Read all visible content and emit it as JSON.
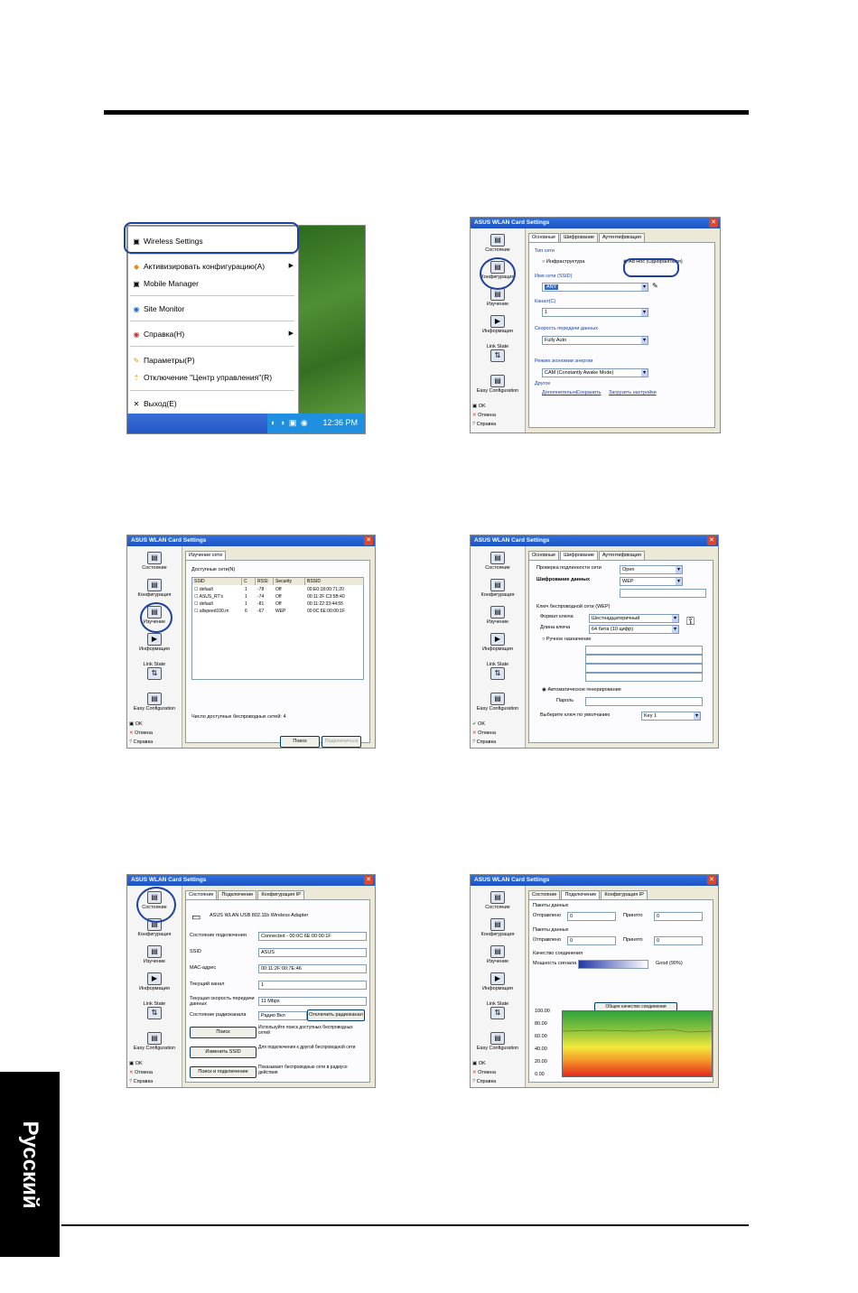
{
  "page": {
    "side_tab": "Русский"
  },
  "shot1": {
    "menu_items": [
      "Wireless Settings",
      "Активизировать конфигурацию(A)",
      "Mobile Manager",
      "Site Monitor",
      "Справка(H)",
      "Параметры(P)",
      "Отключение \"Центр управления\"(R)",
      "Выход(E)"
    ],
    "clock": "12:36 PM"
  },
  "shot2": {
    "title": "ASUS WLAN Card Settings",
    "tabs": [
      "Основные",
      "Шифрование",
      "Аутентификация"
    ],
    "nav": [
      "Состояние",
      "Конфигурация",
      "Изучение",
      "Информация",
      "Link State",
      "Easy Configuration",
      "OK",
      "Отмена",
      "Справка"
    ],
    "network_type_label": "Тип сети",
    "network_type_options": [
      "Инфраструктура",
      "Ad Hoc (Одноранговая)"
    ],
    "ssid_label": "Имя сети (SSID)",
    "ssid_value": "ANY",
    "channel_label": "Канал(C)",
    "channel_value": "1",
    "rate_label": "Скорость передачи данных",
    "rate_value": "Fully Auto",
    "power_label": "Режим экономии энергии",
    "power_value": "CAM (Constantly Awake Mode)",
    "other_label": "Другое",
    "links": [
      "Дополнительно",
      "Сохранить",
      "Загрузить настройки"
    ]
  },
  "shot3": {
    "title": "ASUS WLAN Card Settings",
    "tab": "Изучение сети",
    "list_label": "Доступные сети(N)",
    "columns": [
      "SSID",
      "C",
      "RSSI",
      "Security",
      "BSSID"
    ],
    "rows": [
      [
        "default",
        "1",
        "-78",
        "Off",
        "00:E0:18:00:71:20"
      ],
      [
        "ASUS_RT's",
        "1",
        "-74",
        "Off",
        "00:11:2F:C3:5B:40"
      ],
      [
        "default",
        "1",
        "-81",
        "Off",
        "00:11:22:33:44:55"
      ],
      [
        "allspeed100.m",
        "6",
        "-67",
        "WEP",
        "00:0C:6E:00:00:1F"
      ]
    ],
    "count_text": "Число доступных беспроводных сетей: 4",
    "buttons": [
      "Поиск",
      "Подключиться"
    ]
  },
  "shot4": {
    "title": "ASUS WLAN Card Settings",
    "tabs": [
      "Основные",
      "Шифрование",
      "Аутентификация"
    ],
    "rows": [
      {
        "label": "Проверка подлинности сети",
        "value": "Open"
      },
      {
        "label": "Шифрование данных",
        "value": "WEP"
      },
      {
        "label": "Формат ключа",
        "value": "Шестнадцатеричный"
      },
      {
        "label": "Длина ключа",
        "value": "64 бита (10 цифр)"
      }
    ],
    "key_section": "Ключ беспроводной сети (WEP)",
    "manual": "Ручное назначение",
    "auto": "Автоматическое генерирование",
    "phrase_label": "Пароль",
    "default_key_label": "Выберите ключ по умолчанию",
    "default_key_value": "Key 1"
  },
  "shot5": {
    "title": "ASUS WLAN Card Settings",
    "tabs": [
      "Состояние",
      "Подключение",
      "Конфигурация IP"
    ],
    "adapter": "ASUS WLAN USB 802.11b Wireless Adapter",
    "fields": [
      {
        "label": "Состояние подключения",
        "value": "Connected - 00:0C:6E:00:00:1F"
      },
      {
        "label": "SSID",
        "value": "ASUS"
      },
      {
        "label": "MAC-адрес",
        "value": "00:11:2F:00:7E:46"
      },
      {
        "label": "Текущий канал",
        "value": "1"
      },
      {
        "label": "Текущая скорость передачи данных",
        "value": "11 Mbps"
      },
      {
        "label": "Состояние радиоканала",
        "value": "Радио Вкл"
      }
    ],
    "radio_button": "Отключить радиоканал",
    "actions": [
      {
        "button": "Поиск",
        "desc": "Используйте поиск доступных беспроводных сетей"
      },
      {
        "button": "Изменить SSID",
        "desc": "Для подключения к другой беспроводной сети"
      },
      {
        "button": "Поиск и подключение",
        "desc": "Показывает беспроводные сети в радиусе действия"
      }
    ]
  },
  "shot6": {
    "title": "ASUS WLAN Card Settings",
    "tabs": [
      "Состояние",
      "Подключение",
      "Конфигурация IP"
    ],
    "groups": [
      {
        "title": "Пакеты данных",
        "left_label": "Отправлено",
        "left_value": "0",
        "right_label": "Принято",
        "right_value": "0"
      },
      {
        "title": "Пакеты данных",
        "left_label": "Отправлено",
        "left_value": "0",
        "right_label": "Принято",
        "right_value": "0"
      }
    ],
    "quality_group": "Качество соединения",
    "signal_label": "Мощность сигнала",
    "signal_value": "Good (90%)",
    "chart_title": "Общее качество соединения",
    "y_ticks": [
      "100.00",
      "80.00",
      "60.00",
      "40.00",
      "20.00",
      "0.00"
    ]
  }
}
